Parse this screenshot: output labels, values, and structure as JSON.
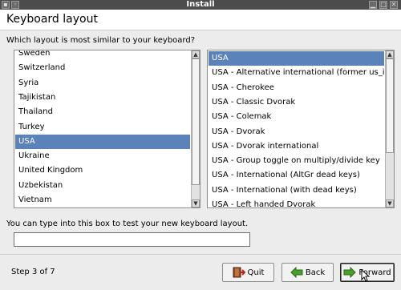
{
  "window": {
    "title": "Install"
  },
  "header": {
    "title": "Keyboard layout"
  },
  "question": "Which layout is most similar to your keyboard?",
  "countries": {
    "items": [
      "Sweden",
      "Switzerland",
      "Syria",
      "Tajikistan",
      "Thailand",
      "Turkey",
      "USA",
      "Ukraine",
      "United Kingdom",
      "Uzbekistan",
      "Vietnam"
    ],
    "selected": "USA"
  },
  "variants": {
    "items": [
      "USA",
      "USA - Alternative international (former us_intl)",
      "USA - Cherokee",
      "USA - Classic Dvorak",
      "USA - Colemak",
      "USA - Dvorak",
      "USA - Dvorak international",
      "USA - Group toggle on multiply/divide key",
      "USA - International (AltGr dead keys)",
      "USA - International (with dead keys)",
      "USA - Left handed Dvorak"
    ],
    "selected": "USA"
  },
  "test": {
    "label": "You can type into this box to test your new keyboard layout.",
    "value": ""
  },
  "footer": {
    "step": "Step 3 of 7",
    "quit_label": "Quit",
    "back_label": "Back",
    "forward_label": "Forward"
  },
  "colors": {
    "selection": "#5b82b9",
    "titlebar": "#4c4c4c"
  }
}
